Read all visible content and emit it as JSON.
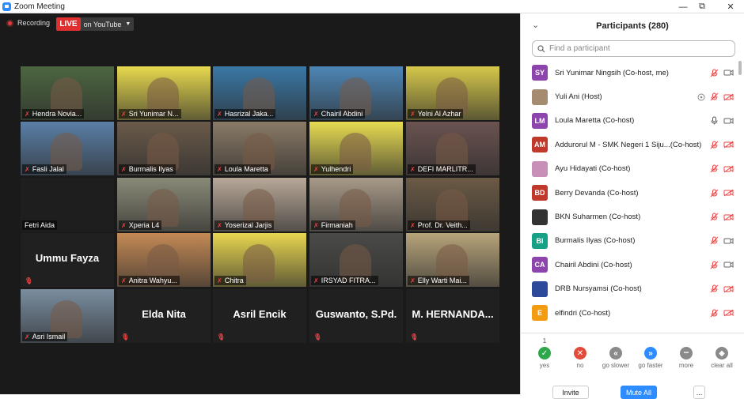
{
  "window": {
    "title": "Zoom Meeting",
    "minimize": "—",
    "restore": "⧉",
    "close": "✕"
  },
  "stream": {
    "recording": "Recording",
    "live": "LIVE",
    "platform": "on YouTube"
  },
  "tiles": [
    {
      "name": "Hendra Novia...",
      "kind": "video",
      "bg": "#4c6640"
    },
    {
      "name": "Sri Yunimar N...",
      "kind": "video",
      "bg": "#e7d94e"
    },
    {
      "name": "Hasrizal Jaka...",
      "kind": "video",
      "bg": "#3a78a6"
    },
    {
      "name": "Chairil Abdini",
      "kind": "video",
      "bg": "#4d86b6"
    },
    {
      "name": "Yelni Al Azhar",
      "kind": "video",
      "bg": "#d6c84a"
    },
    {
      "name": "Fasli Jalal",
      "kind": "video",
      "bg": "#5a7fa6"
    },
    {
      "name": "Burmalis Ilyas",
      "kind": "video",
      "bg": "#6a5a4a"
    },
    {
      "name": "Loula Maretta",
      "kind": "video",
      "bg": "#8a7a66"
    },
    {
      "name": "Yulhendri",
      "kind": "video",
      "bg": "#e8dc52"
    },
    {
      "name": "DEFI MARLITR...",
      "kind": "video",
      "bg": "#6a5350"
    },
    {
      "name": "Fetri Aida",
      "kind": "blank",
      "bg": "#1e1e1e"
    },
    {
      "name": "Xperia L4",
      "kind": "video",
      "bg": "#8a8a78"
    },
    {
      "name": "Yoserizal Jarjis",
      "kind": "video",
      "bg": "#b8a898"
    },
    {
      "name": "Firmaniah",
      "kind": "video",
      "bg": "#a89a88"
    },
    {
      "name": "Prof. Dr. Veith...",
      "kind": "video",
      "bg": "#6b5a45"
    },
    {
      "name": "Ummu Fayza",
      "kind": "text",
      "bg": "#202020"
    },
    {
      "name": "Anitra Wahyu...",
      "kind": "video",
      "bg": "#c48a55"
    },
    {
      "name": "Chitra",
      "kind": "video",
      "bg": "#e8d650"
    },
    {
      "name": "IRSYAD FITRA...",
      "kind": "video",
      "bg": "#4a4a48"
    },
    {
      "name": "Elly Warti Mai...",
      "kind": "video",
      "bg": "#b8a47a"
    },
    {
      "name": "Asri Ismail",
      "kind": "video",
      "bg": "#7a8ea0"
    },
    {
      "name": "Elda Nita",
      "kind": "text",
      "bg": "#202020"
    },
    {
      "name": "Asril Encik",
      "kind": "text",
      "bg": "#202020"
    },
    {
      "name": "Guswanto, S.Pd.",
      "kind": "text",
      "bg": "#202020"
    },
    {
      "name": "M.  HERNANDA...",
      "kind": "text",
      "bg": "#202020"
    }
  ],
  "panel": {
    "collapse": "⌄",
    "title": "Participants (280)",
    "search_placeholder": "Find a participant",
    "participants": [
      {
        "initials": "SY",
        "name": "Sri Yunimar Ningsih (Co-host, me)",
        "color": "#8e44ad",
        "mic": "muted",
        "cam": "on",
        "photo": false
      },
      {
        "initials": "",
        "name": "Yuli Ani (Host)",
        "color": "#a58b70",
        "mic": "muted",
        "cam": "off",
        "photo": true,
        "extra": true
      },
      {
        "initials": "LM",
        "name": "Loula Maretta (Co-host)",
        "color": "#8e44ad",
        "mic": "on",
        "cam": "on",
        "photo": false
      },
      {
        "initials": "AM",
        "name": "Addurorul M - SMK Negeri 1 Siju...(Co-host)",
        "color": "#c0392b",
        "mic": "muted",
        "cam": "off",
        "photo": false
      },
      {
        "initials": "",
        "name": "Ayu Hidayati (Co-host)",
        "color": "#c890b8",
        "mic": "muted",
        "cam": "off",
        "photo": true
      },
      {
        "initials": "BD",
        "name": "Berry Devanda (Co-host)",
        "color": "#c0392b",
        "mic": "muted",
        "cam": "off",
        "photo": false
      },
      {
        "initials": "",
        "name": "BKN Suharmen (Co-host)",
        "color": "#333",
        "mic": "muted",
        "cam": "off",
        "photo": true
      },
      {
        "initials": "BI",
        "name": "Burmalis Ilyas (Co-host)",
        "color": "#16a085",
        "mic": "muted",
        "cam": "on",
        "photo": false
      },
      {
        "initials": "CA",
        "name": "Chairil Abdini (Co-host)",
        "color": "#8e44ad",
        "mic": "muted",
        "cam": "on",
        "photo": false
      },
      {
        "initials": "",
        "name": "DRB Nursyamsi (Co-host)",
        "color": "#2d4a9a",
        "mic": "muted",
        "cam": "off",
        "photo": true
      },
      {
        "initials": "E",
        "name": "elfindri (Co-host)",
        "color": "#f39c12",
        "mic": "muted",
        "cam": "off",
        "photo": false
      }
    ],
    "reactions": [
      {
        "label": "yes",
        "count": "1",
        "color": "#2ea84a",
        "glyph": "✓"
      },
      {
        "label": "no",
        "count": "",
        "color": "#e24a3a",
        "glyph": "✕"
      },
      {
        "label": "go slower",
        "count": "",
        "color": "#8a8a8a",
        "glyph": "«"
      },
      {
        "label": "go faster",
        "count": "",
        "color": "#2d8cff",
        "glyph": "»"
      },
      {
        "label": "more",
        "count": "",
        "color": "#8a8a8a",
        "glyph": "•••"
      },
      {
        "label": "clear all",
        "count": "",
        "color": "#8a8a8a",
        "glyph": "◆"
      }
    ],
    "buttons": {
      "invite": "Invite",
      "mute_all": "Mute All",
      "more": "..."
    }
  }
}
